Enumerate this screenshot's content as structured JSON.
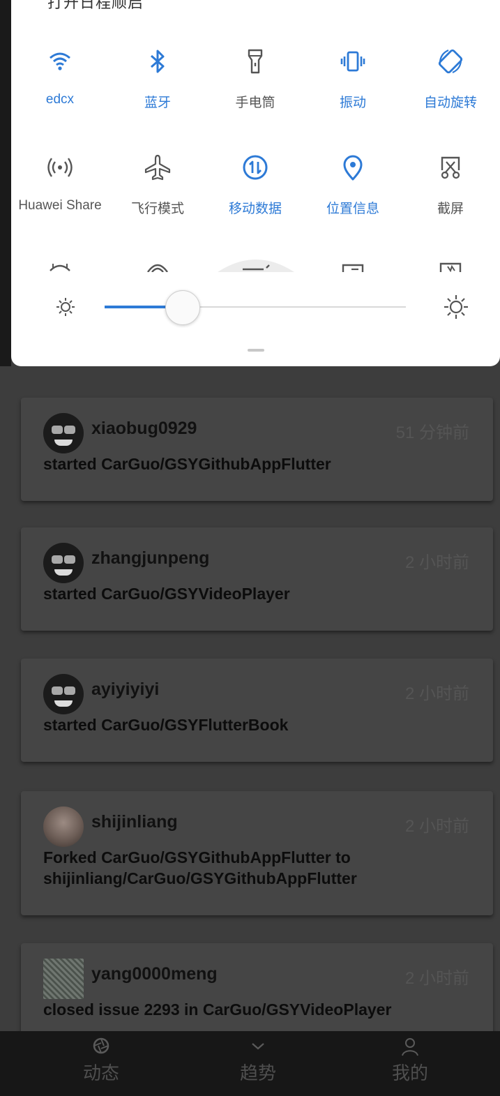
{
  "quick_settings": {
    "top_text": "打开日程顺启",
    "tiles": [
      {
        "label": "edcx",
        "icon": "wifi-icon",
        "active": true
      },
      {
        "label": "蓝牙",
        "icon": "bluetooth-icon",
        "active": true
      },
      {
        "label": "手电筒",
        "icon": "flashlight-icon",
        "active": false
      },
      {
        "label": "振动",
        "icon": "vibrate-icon",
        "active": true
      },
      {
        "label": "自动旋转",
        "icon": "auto-rotate-icon",
        "active": true
      },
      {
        "label": "Huawei Share",
        "icon": "huawei-share-icon",
        "active": false
      },
      {
        "label": "飞行模式",
        "icon": "airplane-icon",
        "active": false
      },
      {
        "label": "移动数据",
        "icon": "mobile-data-icon",
        "active": true
      },
      {
        "label": "位置信息",
        "icon": "location-icon",
        "active": true
      },
      {
        "label": "截屏",
        "icon": "screenshot-icon",
        "active": false
      }
    ],
    "brightness_fraction": 0.22,
    "accent_color": "#2d7ad6"
  },
  "feed": {
    "events": [
      {
        "user": "xiaobug0929",
        "time": "51 分钟前",
        "action": "started CarGuo/GSYGithubAppFlutter",
        "avatar": "hacker-avatar"
      },
      {
        "user": "zhangjunpeng",
        "time": "2 小时前",
        "action": "started CarGuo/GSYVideoPlayer",
        "avatar": "hacker-avatar"
      },
      {
        "user": "ayiyiyiyi",
        "time": "2 小时前",
        "action": "started CarGuo/GSYFlutterBook",
        "avatar": "hacker-avatar"
      },
      {
        "user": "shijinliang",
        "time": "2 小时前",
        "action": "Forked CarGuo/GSYGithubAppFlutter to shijinliang/CarGuo/GSYGithubAppFlutter",
        "avatar": "photo-avatar"
      },
      {
        "user": "yang0000meng",
        "time": "2 小时前",
        "action": "closed issue 2293 in CarGuo/GSYVideoPlayer",
        "avatar": "pattern-avatar"
      }
    ]
  },
  "tabbar": {
    "tabs": [
      {
        "label": "动态",
        "icon": "aperture-icon"
      },
      {
        "label": "趋势",
        "icon": "trend-icon"
      },
      {
        "label": "我的",
        "icon": "person-icon"
      }
    ]
  }
}
